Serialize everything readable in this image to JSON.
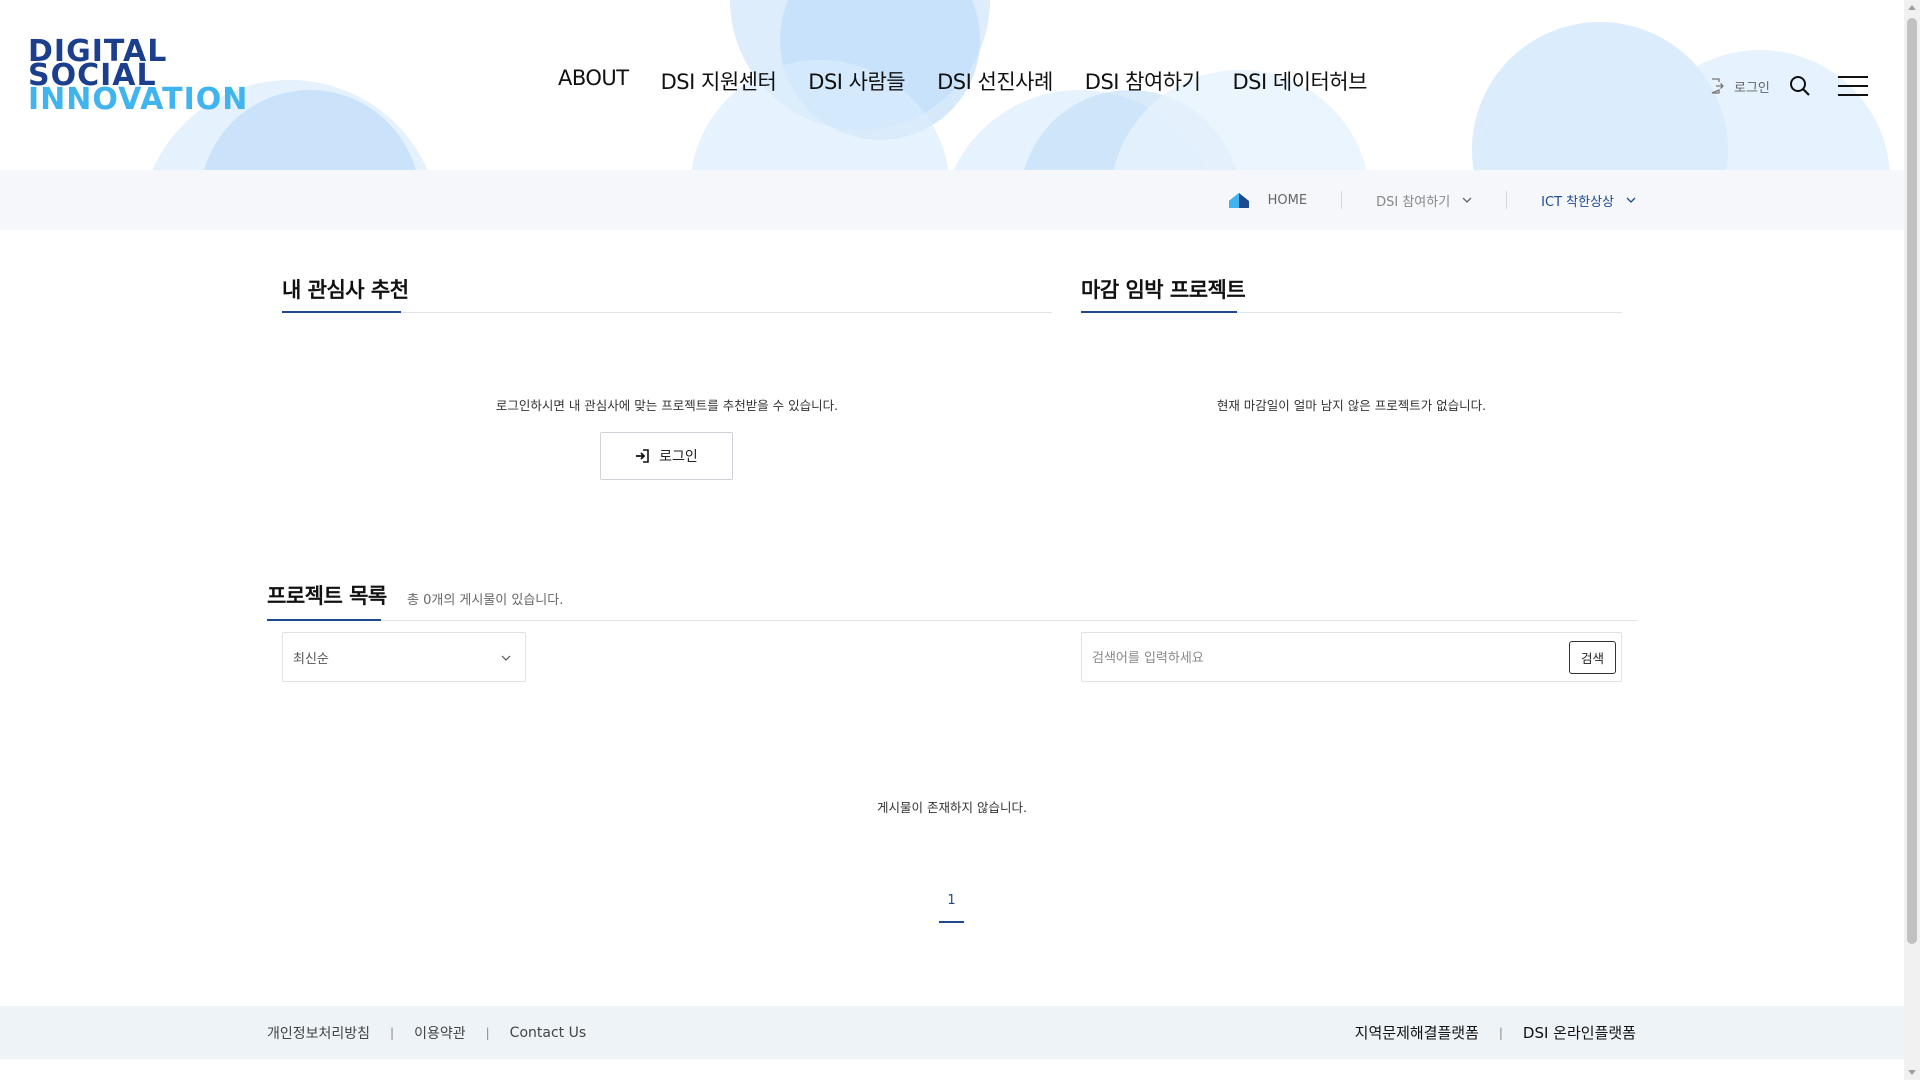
{
  "header": {
    "logo": {
      "line1": "DIGITAL",
      "line2": "SOCIAL",
      "line3": "INNOVATION"
    },
    "nav": [
      {
        "label": "ABOUT"
      },
      {
        "label": "DSI 지원센터"
      },
      {
        "label": "DSI 사람들"
      },
      {
        "label": "DSI 선진사례"
      },
      {
        "label": "DSI 참여하기"
      },
      {
        "label": "DSI 데이터허브"
      }
    ],
    "login_label": "로그인",
    "icons": {
      "login": "login-icon",
      "search": "search-icon",
      "menu": "hamburger-menu-icon"
    }
  },
  "breadcrumb": {
    "home": "HOME",
    "level1": "DSI 참여하기",
    "level2": "ICT 착한상상"
  },
  "recommend": {
    "title": "내 관심사 추천",
    "message": "로그인하시면 내 관심사에 맞는 프로젝트를 추천받을 수 있습니다.",
    "login_button": "로그인"
  },
  "deadline": {
    "title": "마감 임박 프로젝트",
    "message": "현재 마감일이 얼마 남지 않은 프로젝트가 없습니다."
  },
  "project_list": {
    "title": "프로젝트 목록",
    "count_text": "총 0개의 게시물이 있습니다.",
    "sort_selected": "최신순",
    "search_placeholder": "검색어를 입력하세요",
    "search_button": "검색",
    "empty_message": "게시물이 존재하지 않습니다.",
    "current_page": "1"
  },
  "footer": {
    "links": [
      "개인정보처리방침",
      "이용약관",
      "Contact Us"
    ],
    "family_sites": [
      "지역문제해결플랫폼",
      "DSI 온라인플랫폼"
    ]
  },
  "colors": {
    "accent": "#1d4a8f",
    "logo_dark": "#1b3f8c",
    "logo_light": "#3fb4ee",
    "bubble": "#cfe6fb"
  }
}
